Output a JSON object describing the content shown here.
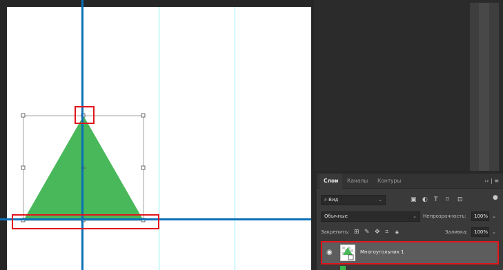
{
  "layers_panel": {
    "tabs": [
      {
        "label": "Слои",
        "active": true
      },
      {
        "label": "Каналы",
        "active": false
      },
      {
        "label": "Контуры",
        "active": false
      }
    ],
    "menu_label": "›› | ≡",
    "filter": {
      "value": "Вид"
    },
    "blend_mode": {
      "value": "Обычные"
    },
    "opacity": {
      "label": "Непрозрачность:",
      "value": "100%"
    },
    "lock": {
      "label": "Закрепить:"
    },
    "fill": {
      "label": "Заливка:",
      "value": "100%"
    },
    "layers": [
      {
        "name": "Многоугольник 1",
        "visible": true,
        "selected": true
      }
    ]
  },
  "colors": {
    "shape_fill": "#49b85a",
    "guide_strong": "#0a6fb8",
    "guide_light": "#7ff2f0",
    "highlight": "#e2141b"
  }
}
